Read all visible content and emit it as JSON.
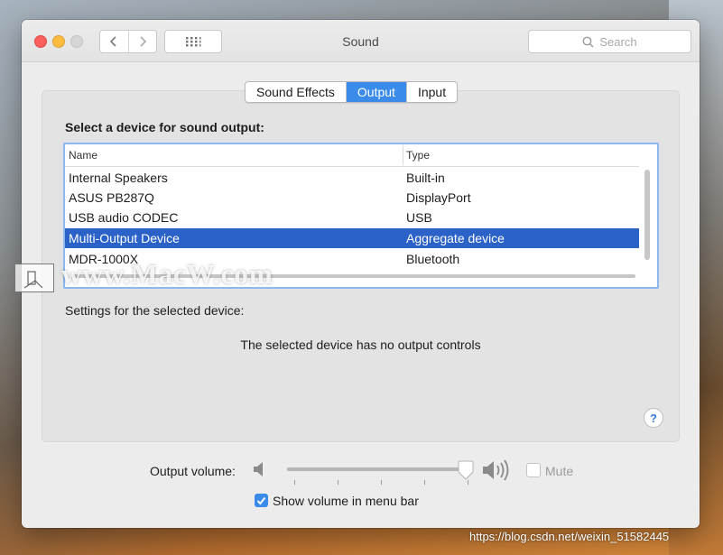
{
  "window": {
    "title": "Sound"
  },
  "search": {
    "placeholder": "Search"
  },
  "tabs": [
    {
      "label": "Sound Effects",
      "active": false
    },
    {
      "label": "Output",
      "active": true
    },
    {
      "label": "Input",
      "active": false
    }
  ],
  "output": {
    "heading": "Select a device for sound output:",
    "columns": {
      "name": "Name",
      "type": "Type"
    },
    "devices": [
      {
        "name": "Internal Speakers",
        "type": "Built-in",
        "selected": false
      },
      {
        "name": "ASUS PB287Q",
        "type": "DisplayPort",
        "selected": false
      },
      {
        "name": "USB audio CODEC",
        "type": "USB",
        "selected": false
      },
      {
        "name": "Multi-Output Device",
        "type": "Aggregate device",
        "selected": true
      },
      {
        "name": "MDR-1000X",
        "type": "Bluetooth",
        "selected": false
      }
    ],
    "settings_label": "Settings for the selected device:",
    "no_controls_text": "The selected device has no output controls",
    "help": "?"
  },
  "volume": {
    "label": "Output volume:",
    "level": 0.99,
    "mute_label": "Mute",
    "mute_checked": false,
    "show_in_menu_bar_label": "Show volume in menu bar",
    "show_in_menu_bar_checked": true
  },
  "overlay": {
    "watermark": "www.MacW.com",
    "credit": "https://blog.csdn.net/weixin_51582445"
  },
  "colors": {
    "accent": "#3b8bea",
    "selection": "#2a62c8",
    "close": "#fc605c",
    "minimize": "#fdbc40"
  }
}
